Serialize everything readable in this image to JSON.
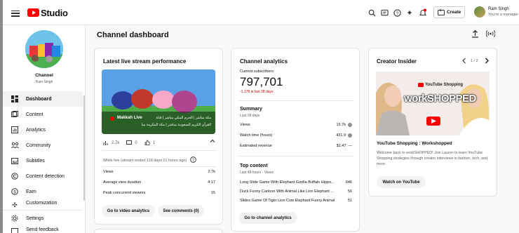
{
  "header": {
    "brand": "Studio",
    "create_label": "Create",
    "user_name": "Ram Singh",
    "user_sub": "You're a manager"
  },
  "sidebar": {
    "channel_title": "Channel",
    "channel_name": "Ram Singh",
    "items": [
      {
        "label": "Dashboard",
        "icon": "dashboard-icon"
      },
      {
        "label": "Content",
        "icon": "content-icon"
      },
      {
        "label": "Analytics",
        "icon": "analytics-icon"
      },
      {
        "label": "Community",
        "icon": "community-icon"
      },
      {
        "label": "Subtitles",
        "icon": "subtitles-icon"
      },
      {
        "label": "Content detection",
        "icon": "copyright-icon"
      },
      {
        "label": "Earn",
        "icon": "earn-icon"
      },
      {
        "label": "Customization",
        "icon": "customization-icon"
      },
      {
        "label": "Settings",
        "icon": "settings-icon"
      },
      {
        "label": "Send feedback",
        "icon": "feedback-icon"
      }
    ]
  },
  "page": {
    "title": "Channel dashboard"
  },
  "live": {
    "title": "Latest live stream performance",
    "video_badge": "Makkah Live",
    "video_title_line1": "مكة مباشر | الحرم المكي مباشر | قناة",
    "video_title_line2": "القرآن الكريم السعودية مباشر | مكة المكرمة مبا",
    "stat_views": "2.7k",
    "stat_comments": "0",
    "stat_likes": "1",
    "status_text": "While live (stream ended 116 days 21 hours ago)",
    "rows": [
      {
        "label": "Views",
        "value": "2.7k"
      },
      {
        "label": "Average view duration",
        "value": "4:17"
      },
      {
        "label": "Peak concurrent viewers",
        "value": "15"
      }
    ],
    "btn_analytics": "Go to video analytics",
    "btn_comments": "See comments (0)"
  },
  "analytics": {
    "title": "Channel analytics",
    "subs_label": "Current subscribers",
    "subs_value": "797,701",
    "subs_change": "-1,178 in last 28 days",
    "summary_title": "Summary",
    "summary_sub": "Last 28 days",
    "summary_rows": [
      {
        "label": "Views",
        "value": "15.7k",
        "indicator": "dot"
      },
      {
        "label": "Watch time (hours)",
        "value": "431.9",
        "indicator": "dot"
      },
      {
        "label": "Estimated revenue",
        "value": "$1.47",
        "indicator": "—"
      }
    ],
    "top_title": "Top content",
    "top_sub": "Last 48 hours · Views",
    "top_rows": [
      {
        "label": "Long Slide Game With Elephant Gorilla Buffalo Hippo...",
        "value": "646"
      },
      {
        "label": "Duck Funny Cartoon With Animal Like Lion Elephant ...",
        "value": "56"
      },
      {
        "label": "Slides Game Of Tiger Lion Cow Elephant Funny Animal",
        "value": "51"
      }
    ],
    "btn_label": "Go to channel analytics"
  },
  "insider": {
    "title": "Creator Insider",
    "pager": "1 / 2",
    "thumb_brand": "YouTube Shopping",
    "thumb_text": "workSHOPPED",
    "video_title": "YouTube Shopping : Workshopped",
    "desc": "Welcome back to workSHOPPED! Join Lauren to learn YouTube Shopping strategies through creator interviews in fashion, tech, and more.",
    "btn_label": "Watch on YouTube"
  }
}
